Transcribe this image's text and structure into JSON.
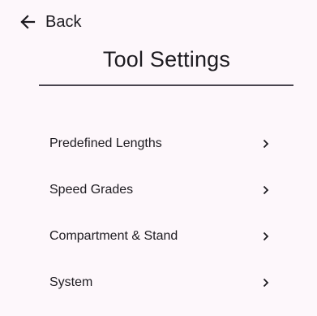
{
  "header": {
    "back_label": "Back",
    "title": "Tool Settings"
  },
  "menu": {
    "items": [
      {
        "label": "Predefined Lengths",
        "icon": "chevron-right-icon"
      },
      {
        "label": "Speed Grades",
        "icon": "chevron-right-icon"
      },
      {
        "label": "Compartment & Stand",
        "icon": "chevron-right-icon"
      },
      {
        "label": "System",
        "icon": "chevron-right-icon"
      }
    ]
  },
  "colors": {
    "background": "#fdf7fb",
    "text": "#1d1b20",
    "divider": "#49454f"
  }
}
